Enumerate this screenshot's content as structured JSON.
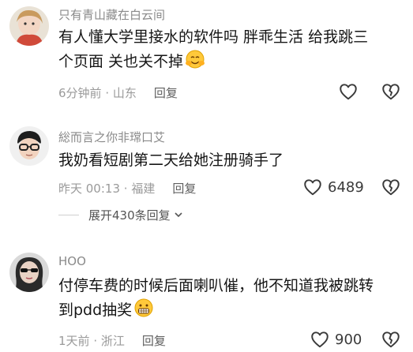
{
  "comments": [
    {
      "username": "只有青山藏在白云间",
      "text": "有人懂大学里接水的软件吗 胖乖生活 给我跳三个页面 关也关不掉",
      "emoji_icon": "hugging-face-emoji",
      "time": "6分钟前",
      "location": "山东",
      "reply_label": "回复",
      "like_count": ""
    },
    {
      "username": "総而言之你非瑺口艾",
      "text": "我奶看短剧第二天给她注册骑手了",
      "time": "昨天 00:13",
      "location": "福建",
      "reply_label": "回复",
      "like_count": "6489"
    },
    {
      "username": "HOO",
      "text": "付停车费的时候后面喇叭催，他不知道我被跳转到pdd抽奖",
      "emoji_icon": "grimacing-face-emoji",
      "time": "1天前",
      "location": "浙江",
      "reply_label": "回复",
      "like_count": "900"
    }
  ],
  "expand_replies": {
    "label": "展开430条回复"
  },
  "separator": " · ",
  "colors": {
    "text": "#161616",
    "meta": "#9a9a9a",
    "username": "#8a8a8a",
    "icon": "#3a3a3a"
  }
}
